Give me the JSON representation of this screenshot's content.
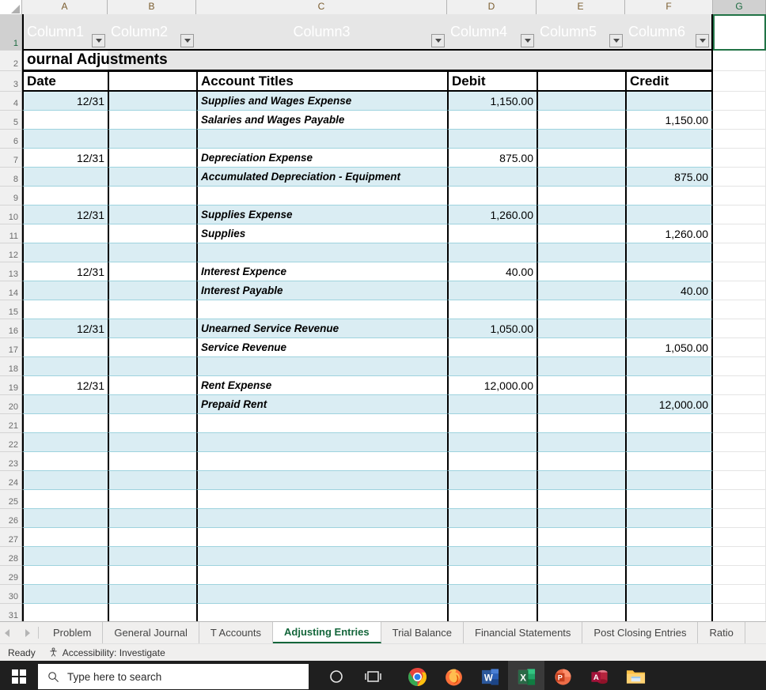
{
  "spreadsheet": {
    "column_headers": [
      "A",
      "B",
      "C",
      "D",
      "E",
      "F",
      "G"
    ],
    "selected_cell": "G1",
    "table_header_row": {
      "row_number": "1",
      "labels": [
        "Column1",
        "Column2",
        "Column3",
        "Column4",
        "Column5",
        "Column6"
      ]
    },
    "title_row": {
      "row_number": "2",
      "title": "ournal Adjustments"
    },
    "header_row": {
      "row_number": "3",
      "date": "Date",
      "blank_b": "",
      "account_titles": "Account Titles",
      "debit": "Debit",
      "blank_e": "",
      "credit": "Credit"
    },
    "rows": [
      {
        "n": "4",
        "band": true,
        "date": "12/31",
        "b": "",
        "account": "Supplies and Wages Expense",
        "debit": "1,150.00",
        "e": "",
        "credit": ""
      },
      {
        "n": "5",
        "band": false,
        "date": "",
        "b": "",
        "account": "Salaries and Wages Payable",
        "debit": "",
        "e": "",
        "credit": "1,150.00"
      },
      {
        "n": "6",
        "band": true,
        "date": "",
        "b": "",
        "account": "",
        "debit": "",
        "e": "",
        "credit": ""
      },
      {
        "n": "7",
        "band": false,
        "date": "12/31",
        "b": "",
        "account": "Depreciation Expense",
        "debit": "875.00",
        "e": "",
        "credit": ""
      },
      {
        "n": "8",
        "band": true,
        "date": "",
        "b": "",
        "account": "Accumulated Depreciation - Equipment",
        "debit": "",
        "e": "",
        "credit": "875.00"
      },
      {
        "n": "9",
        "band": false,
        "date": "",
        "b": "",
        "account": "",
        "debit": "",
        "e": "",
        "credit": ""
      },
      {
        "n": "10",
        "band": true,
        "date": "12/31",
        "b": "",
        "account": "Supplies Expense",
        "debit": "1,260.00",
        "e": "",
        "credit": ""
      },
      {
        "n": "11",
        "band": false,
        "date": "",
        "b": "",
        "account": "Supplies",
        "debit": "",
        "e": "",
        "credit": "1,260.00"
      },
      {
        "n": "12",
        "band": true,
        "date": "",
        "b": "",
        "account": "",
        "debit": "",
        "e": "",
        "credit": ""
      },
      {
        "n": "13",
        "band": false,
        "date": "12/31",
        "b": "",
        "account": "Interest Expence",
        "debit": "40.00",
        "e": "",
        "credit": ""
      },
      {
        "n": "14",
        "band": true,
        "date": "",
        "b": "",
        "account": "Interest Payable",
        "debit": "",
        "e": "",
        "credit": "40.00"
      },
      {
        "n": "15",
        "band": false,
        "date": "",
        "b": "",
        "account": "",
        "debit": "",
        "e": "",
        "credit": ""
      },
      {
        "n": "16",
        "band": true,
        "date": "12/31",
        "b": "",
        "account": "Unearned Service Revenue",
        "debit": "1,050.00",
        "e": "",
        "credit": ""
      },
      {
        "n": "17",
        "band": false,
        "date": "",
        "b": "",
        "account": "Service Revenue",
        "debit": "",
        "e": "",
        "credit": "1,050.00"
      },
      {
        "n": "18",
        "band": true,
        "date": "",
        "b": "",
        "account": "",
        "debit": "",
        "e": "",
        "credit": ""
      },
      {
        "n": "19",
        "band": false,
        "date": "12/31",
        "b": "",
        "account": "Rent Expense",
        "debit": "12,000.00",
        "e": "",
        "credit": ""
      },
      {
        "n": "20",
        "band": true,
        "date": "",
        "b": "",
        "account": "Prepaid Rent",
        "debit": "",
        "e": "",
        "credit": "12,000.00"
      },
      {
        "n": "21",
        "band": false,
        "date": "",
        "b": "",
        "account": "",
        "debit": "",
        "e": "",
        "credit": ""
      },
      {
        "n": "22",
        "band": true,
        "date": "",
        "b": "",
        "account": "",
        "debit": "",
        "e": "",
        "credit": ""
      },
      {
        "n": "23",
        "band": false,
        "date": "",
        "b": "",
        "account": "",
        "debit": "",
        "e": "",
        "credit": ""
      },
      {
        "n": "24",
        "band": true,
        "date": "",
        "b": "",
        "account": "",
        "debit": "",
        "e": "",
        "credit": ""
      },
      {
        "n": "25",
        "band": false,
        "date": "",
        "b": "",
        "account": "",
        "debit": "",
        "e": "",
        "credit": ""
      },
      {
        "n": "26",
        "band": true,
        "date": "",
        "b": "",
        "account": "",
        "debit": "",
        "e": "",
        "credit": ""
      },
      {
        "n": "27",
        "band": false,
        "date": "",
        "b": "",
        "account": "",
        "debit": "",
        "e": "",
        "credit": ""
      },
      {
        "n": "28",
        "band": true,
        "date": "",
        "b": "",
        "account": "",
        "debit": "",
        "e": "",
        "credit": ""
      },
      {
        "n": "29",
        "band": false,
        "date": "",
        "b": "",
        "account": "",
        "debit": "",
        "e": "",
        "credit": ""
      },
      {
        "n": "30",
        "band": true,
        "date": "",
        "b": "",
        "account": "",
        "debit": "",
        "e": "",
        "credit": ""
      },
      {
        "n": "31",
        "band": false,
        "date": "",
        "b": "",
        "account": "",
        "debit": "",
        "e": "",
        "credit": ""
      }
    ]
  },
  "sheet_tabs": {
    "tabs": [
      {
        "label": "Problem",
        "active": false
      },
      {
        "label": "General Journal",
        "active": false
      },
      {
        "label": "T Accounts",
        "active": false
      },
      {
        "label": "Adjusting Entries",
        "active": true
      },
      {
        "label": "Trial Balance",
        "active": false
      },
      {
        "label": "Financial Statements",
        "active": false
      },
      {
        "label": "Post Closing Entries",
        "active": false
      },
      {
        "label": "Ratio",
        "active": false
      }
    ]
  },
  "status_bar": {
    "mode": "Ready",
    "accessibility": "Accessibility: Investigate"
  },
  "taskbar": {
    "search_placeholder": "Type here to search",
    "apps": [
      {
        "name": "cortana-icon",
        "label": "Cortana"
      },
      {
        "name": "task-view-icon",
        "label": "Task View"
      },
      {
        "name": "chrome-icon",
        "label": "Google Chrome"
      },
      {
        "name": "firefox-icon",
        "label": "Mozilla Firefox"
      },
      {
        "name": "word-icon",
        "label": "Microsoft Word"
      },
      {
        "name": "excel-icon",
        "label": "Microsoft Excel"
      },
      {
        "name": "powerpoint-icon",
        "label": "Microsoft PowerPoint"
      },
      {
        "name": "access-icon",
        "label": "Microsoft Access"
      },
      {
        "name": "file-explorer-icon",
        "label": "File Explorer"
      }
    ]
  },
  "colors": {
    "band": "#daedf3",
    "band_border": "#9ed3de",
    "excel_green": "#217346",
    "active_tab_text": "#14663b"
  }
}
